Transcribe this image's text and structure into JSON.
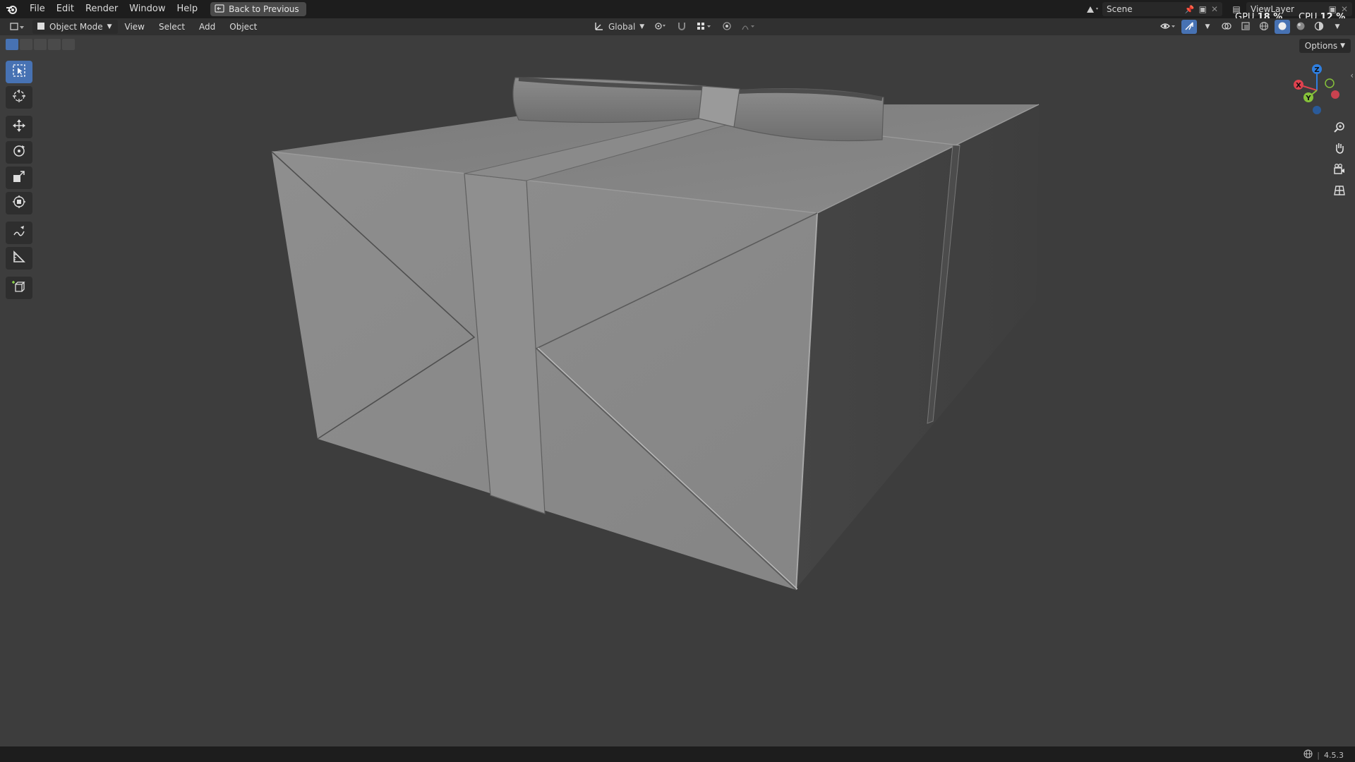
{
  "topbar": {
    "menus": [
      "File",
      "Edit",
      "Render",
      "Window",
      "Help"
    ],
    "back_button": "Back to Previous",
    "scene_name": "Scene",
    "view_layer": "ViewLayer",
    "gpu_label": "GPU",
    "gpu_value": "18 %",
    "cpu_label": "CPU",
    "cpu_value": "12 %"
  },
  "header": {
    "mode": "Object Mode",
    "menus": [
      "View",
      "Select",
      "Add",
      "Object"
    ],
    "transform_orientation": "Global",
    "options_label": "Options"
  },
  "toolbar": {
    "tools": [
      "select-box",
      "cursor",
      "move",
      "rotate",
      "scale",
      "transform",
      "annotate",
      "measure",
      "add-cube"
    ],
    "active": "select-box"
  },
  "gizmo": {
    "z_label": "Z",
    "y_label": "Y",
    "x_label": "X"
  },
  "statusbar": {
    "version": "4.5.3"
  },
  "colors": {
    "accent": "#4772b3",
    "viewport_bg": "#3d3d3d",
    "x_axis": "#e0424f",
    "y_axis": "#86c23a",
    "z_axis": "#2f7fe0"
  }
}
